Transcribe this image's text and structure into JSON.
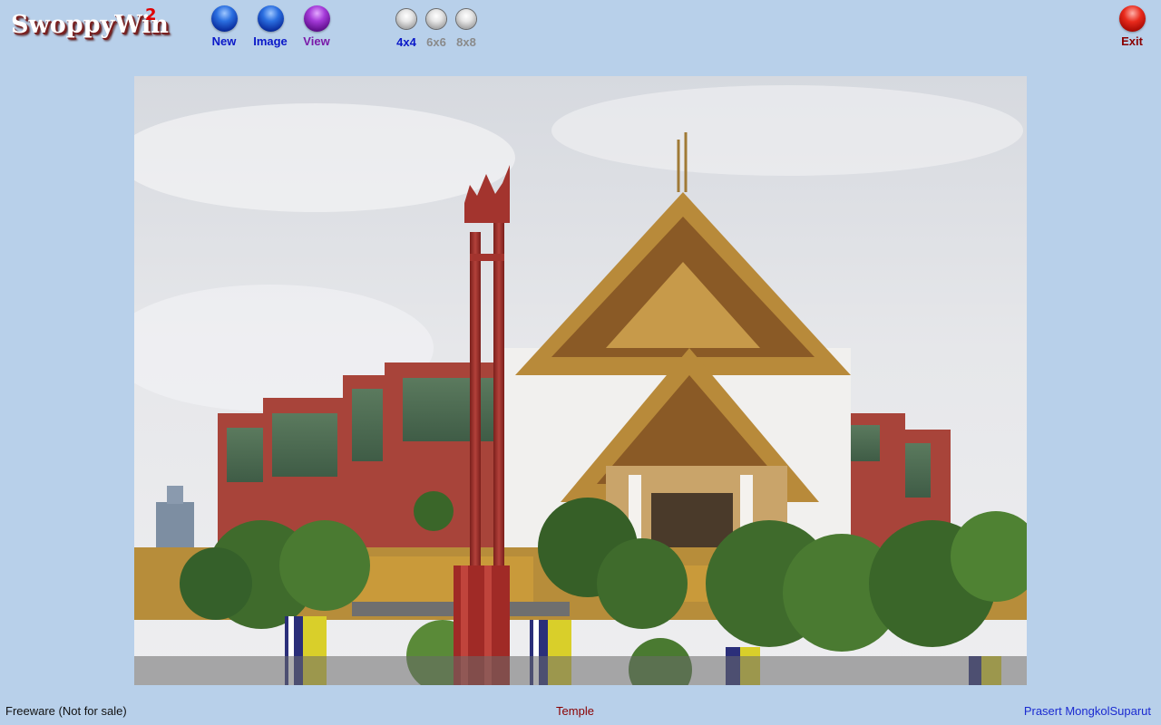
{
  "app": {
    "logo_text": "SwoppyWin",
    "logo_superscript": "2"
  },
  "toolbar": {
    "new_label": "New",
    "image_label": "Image",
    "view_label": "View",
    "grid_4_label": "4x4",
    "grid_6_label": "6x6",
    "grid_8_label": "8x8",
    "exit_label": "Exit",
    "selected_grid": "4x4"
  },
  "icons": {
    "new": "blue-orb-icon",
    "image": "blue-orb-icon",
    "view": "purple-orb-icon",
    "grid": "grey-radio-icon",
    "exit": "red-orb-icon"
  },
  "puzzle": {
    "image_subject": "Temple"
  },
  "status_bar": {
    "left_text": "Freeware (Not for sale)",
    "center_text": "Temple",
    "right_text": "Prasert MongkolSuparut"
  },
  "colors": {
    "background": "#b8d0ea",
    "active_label": "#0a18c8",
    "view_label": "#7a1aa8",
    "disabled_label": "#8a8a8a",
    "exit_label": "#8a0000",
    "caption": "#8a0000",
    "author": "#1a2ad0"
  }
}
